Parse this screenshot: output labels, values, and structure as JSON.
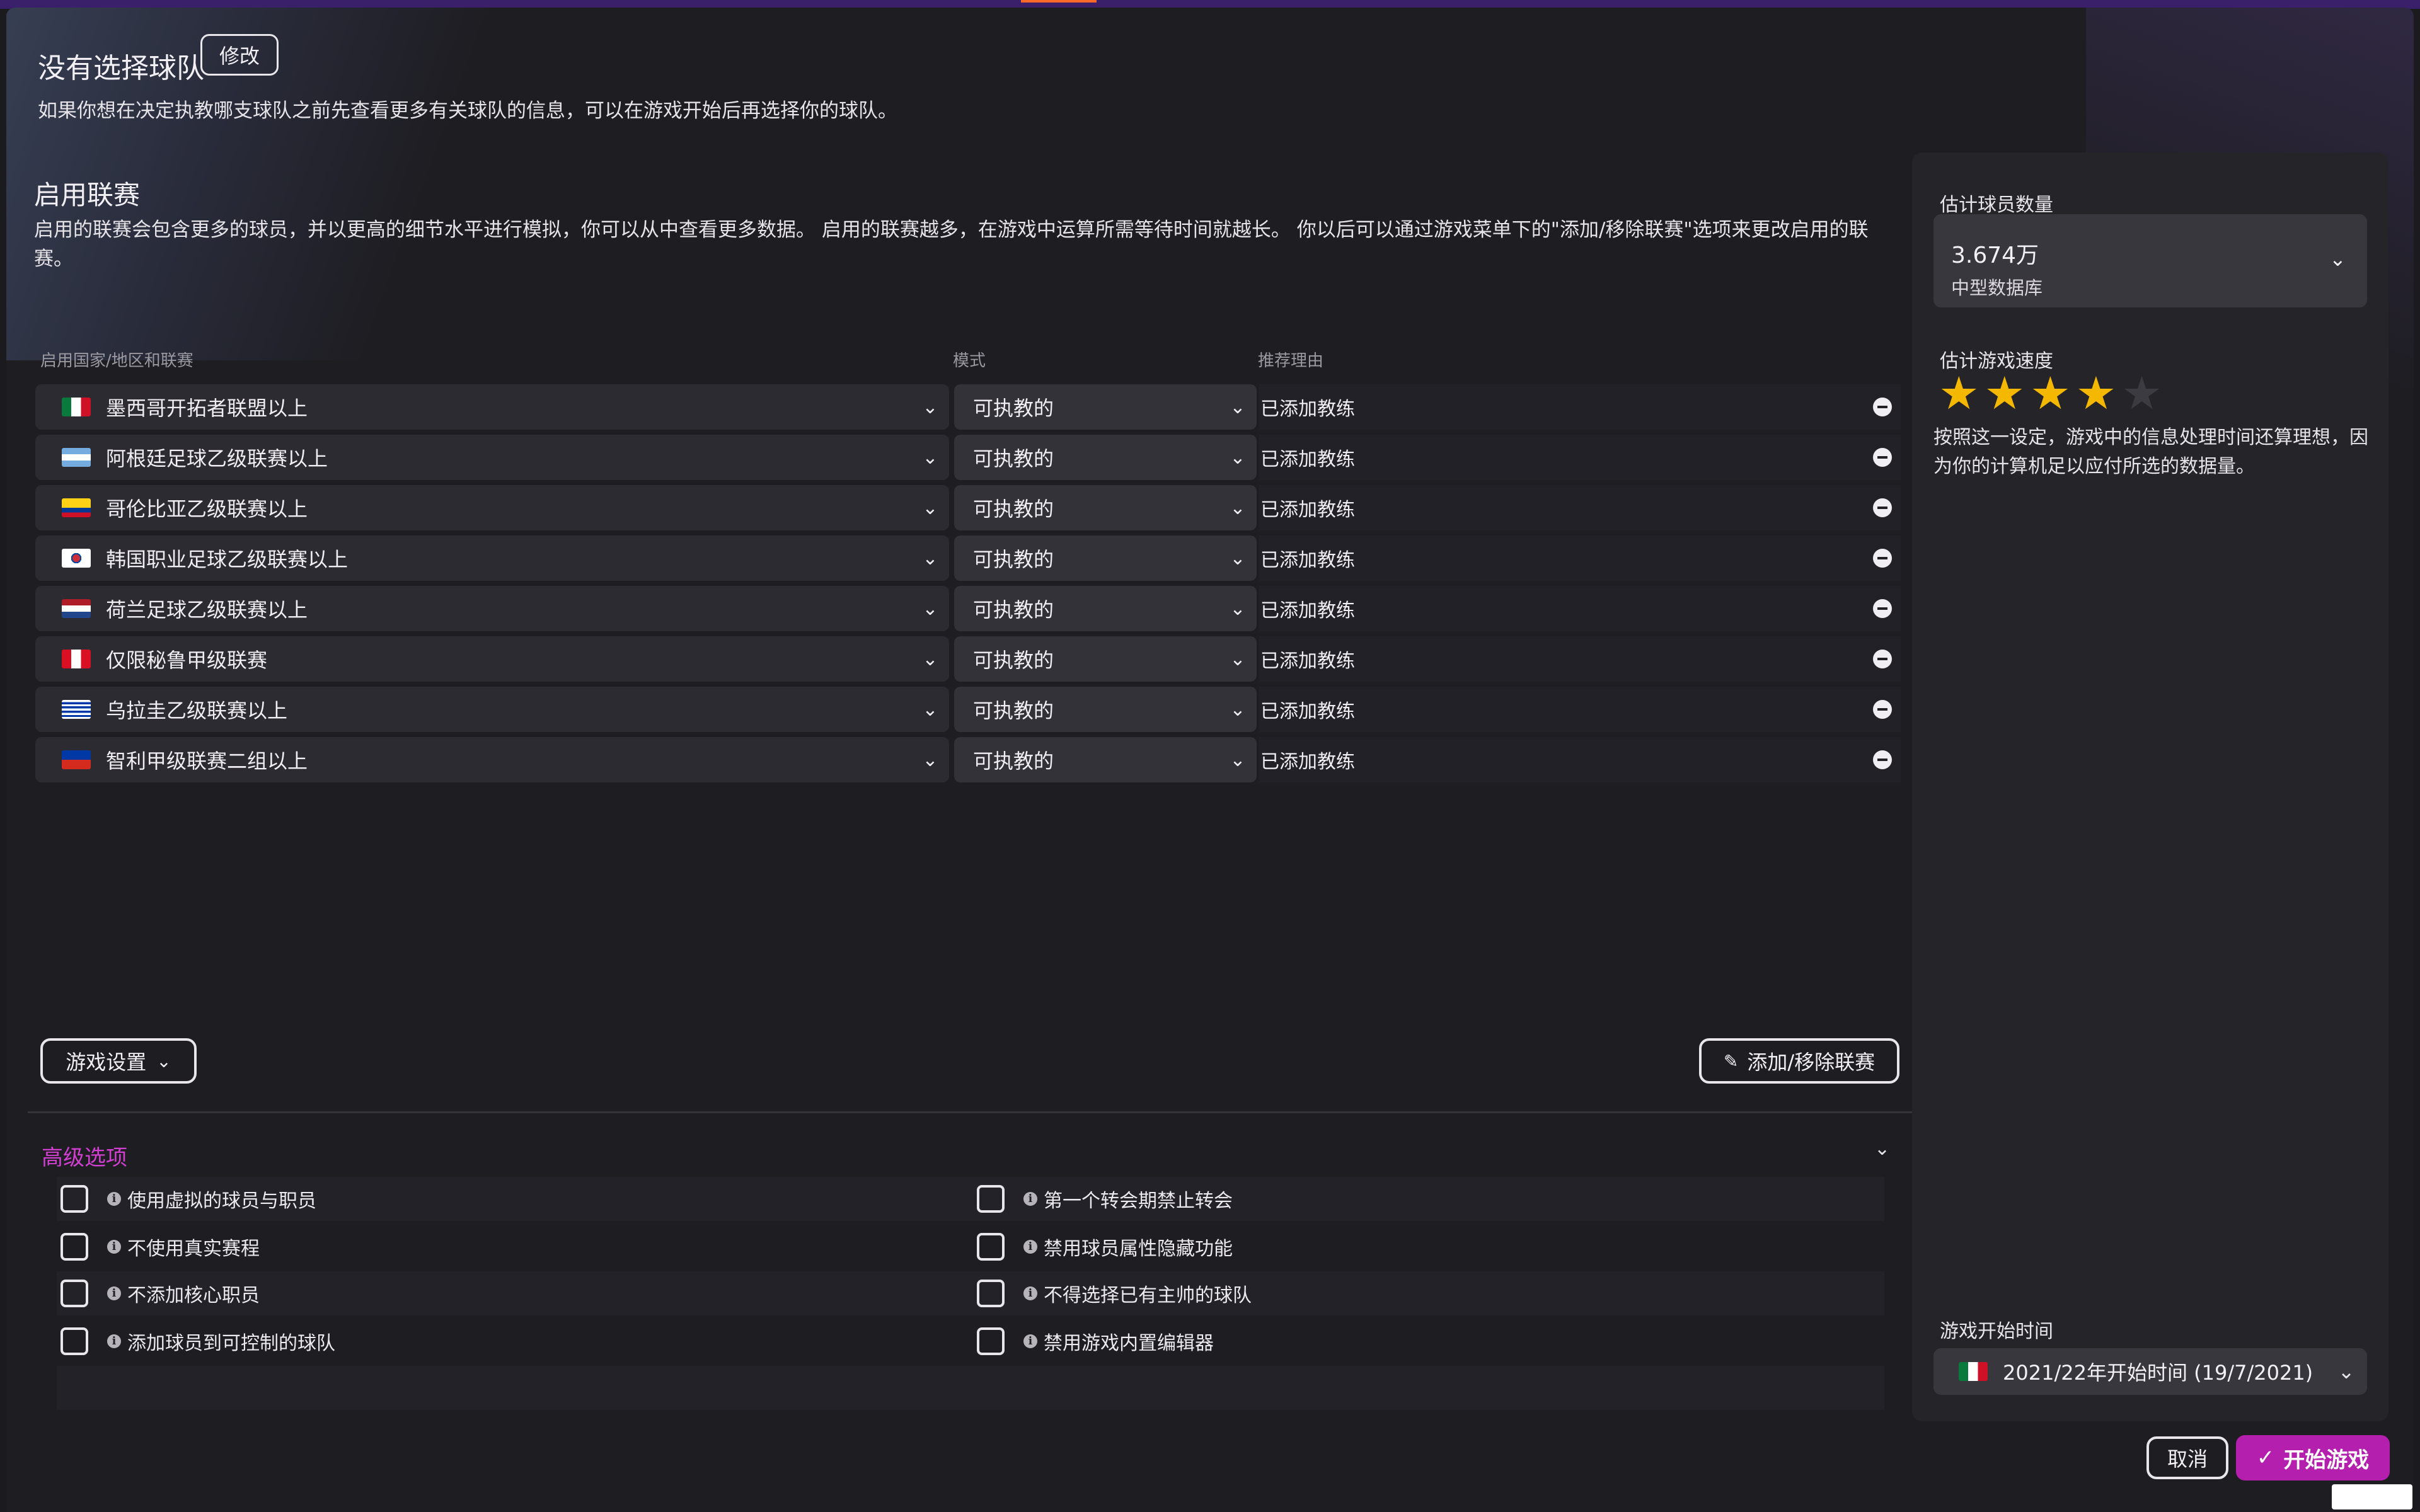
{
  "header": {
    "title": "没有选择球队",
    "edit_label": "修改",
    "subtitle": "如果你想在决定执教哪支球队之前先查看更多有关球队的信息，可以在游戏开始后再选择你的球队。"
  },
  "leagues_section": {
    "title": "启用联赛",
    "description": "启用的联赛会包含更多的球员，并以更高的细节水平进行模拟，你可以从中查看更多数据。 启用的联赛越多，在游戏中运算所需等待时间就越长。 你以后可以通过游戏菜单下的\"添加/移除联赛\"选项来更改启用的联赛。",
    "columns": {
      "league": "启用国家/地区和联赛",
      "mode": "模式",
      "reason": "推荐理由"
    },
    "rows": [
      {
        "flag": "mexico-flag",
        "league": "墨西哥开拓者联盟以上",
        "mode": "可执教的",
        "reason": "已添加教练"
      },
      {
        "flag": "argentina-flag",
        "league": "阿根廷足球乙级联赛以上",
        "mode": "可执教的",
        "reason": "已添加教练"
      },
      {
        "flag": "colombia-flag",
        "league": "哥伦比亚乙级联赛以上",
        "mode": "可执教的",
        "reason": "已添加教练"
      },
      {
        "flag": "south-korea-flag",
        "league": "韩国职业足球乙级联赛以上",
        "mode": "可执教的",
        "reason": "已添加教练"
      },
      {
        "flag": "netherlands-flag",
        "league": "荷兰足球乙级联赛以上",
        "mode": "可执教的",
        "reason": "已添加教练"
      },
      {
        "flag": "peru-flag",
        "league": "仅限秘鲁甲级联赛",
        "mode": "可执教的",
        "reason": "已添加教练"
      },
      {
        "flag": "uruguay-flag",
        "league": "乌拉圭乙级联赛以上",
        "mode": "可执教的",
        "reason": "已添加教练"
      },
      {
        "flag": "chile-flag",
        "league": "智利甲级联赛二组以上",
        "mode": "可执教的",
        "reason": "已添加教练"
      }
    ],
    "game_settings_label": "游戏设置",
    "add_remove_label": "添加/移除联赛"
  },
  "advanced": {
    "title": "高级选项",
    "left_options": [
      "使用虚拟的球员与职员",
      "不使用真实赛程",
      "不添加核心职员",
      "添加球员到可控制的球队"
    ],
    "right_options": [
      "第一个转会期禁止转会",
      "禁用球员属性隐藏功能",
      "不得选择已有主帅的球队",
      "禁用游戏内置编辑器"
    ]
  },
  "sidebar": {
    "player_count_label": "估计球员数量",
    "player_count_value": "3.674万",
    "database_size": "中型数据库",
    "speed_label": "估计游戏速度",
    "speed_rating": 4,
    "speed_max": 5,
    "speed_desc": "按照这一设定，游戏中的信息处理时间还算理想，因为你的计算机足以应付所选的数据量。",
    "start_time_label": "游戏开始时间",
    "start_time_value": "2021/22年开始时间 (19/7/2021)"
  },
  "footer": {
    "cancel_label": "取消",
    "start_label": "开始游戏"
  },
  "colors": {
    "accent": "#b51fae",
    "advanced_title": "#d13fd1",
    "star": "#f5b800"
  }
}
